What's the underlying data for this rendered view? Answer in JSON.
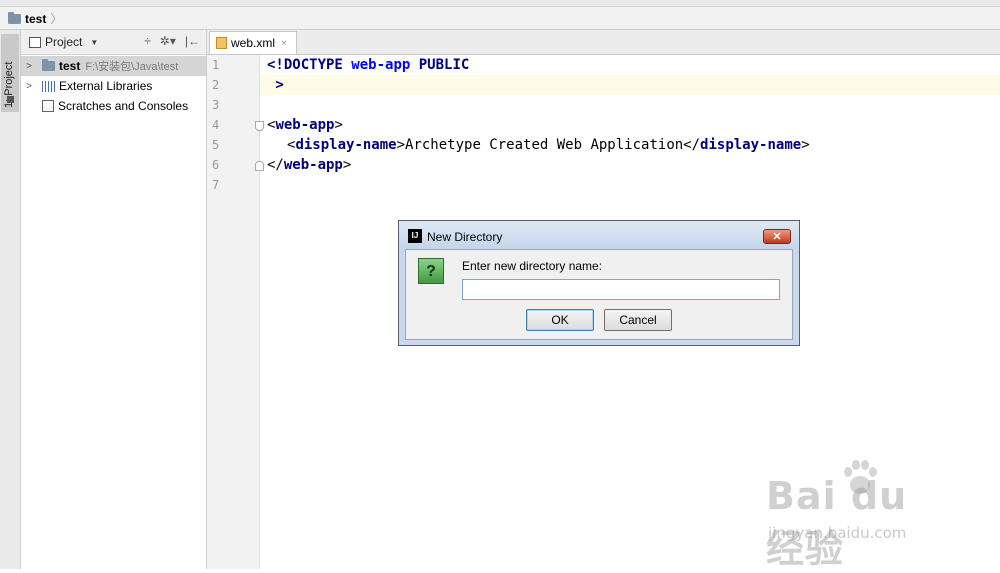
{
  "navbar": {
    "crumb": "test"
  },
  "left_strip": {
    "tab_label": "1: Project"
  },
  "project_panel": {
    "title": "Project",
    "tools": [
      "÷",
      "✲▾",
      "|←"
    ],
    "tree": [
      {
        "label": "test",
        "path": "F:\\安装包\\Java\\test",
        "bold": true,
        "selected": true,
        "expandable": true
      },
      {
        "label": "External Libraries",
        "path": "",
        "bold": false,
        "selected": false,
        "expandable": true
      },
      {
        "label": "Scratches and Consoles",
        "path": "",
        "bold": false,
        "selected": false,
        "expandable": false
      }
    ]
  },
  "editor": {
    "tab": {
      "label": "web.xml",
      "close": "×"
    },
    "line_numbers": [
      "1",
      "2",
      "3",
      "4",
      "5",
      "6",
      "7"
    ],
    "lines": {
      "l1_a": "<!DOCTYPE",
      "l1_b": "web-app",
      "l1_c": "PUBLIC",
      "l2": " >",
      "l4_open": "<",
      "l4_tag": "web-app",
      "l4_close": ">",
      "l5_open": "<",
      "l5_tag": "display-name",
      "l5_mid": ">Archetype Created Web Application</",
      "l5_tag2": "display-name",
      "l5_close": ">",
      "l6_open": "</",
      "l6_tag": "web-app",
      "l6_close": ">"
    }
  },
  "dialog": {
    "title": "New Directory",
    "close": "✕",
    "icon": "?",
    "prompt": "Enter new directory name:",
    "input_value": "",
    "ok_label": "OK",
    "cancel_label": "Cancel"
  },
  "watermark": {
    "main": "Bai du 经验",
    "sub": "jingyan.baidu.com"
  }
}
